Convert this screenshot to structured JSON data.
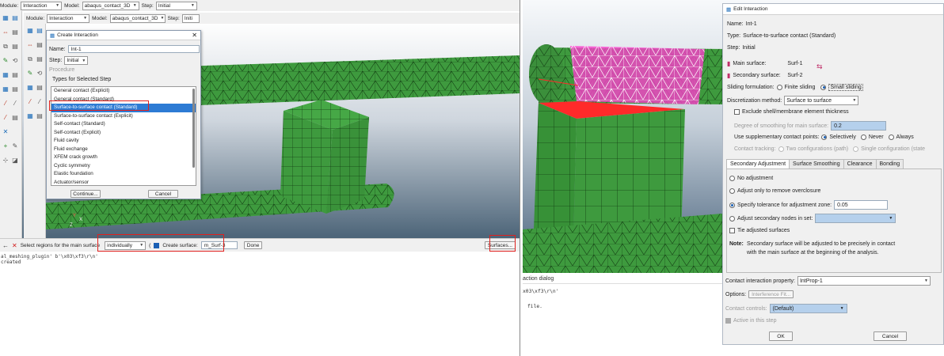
{
  "left": {
    "context_back": {
      "module_label": "Module:",
      "module_value": "Interaction",
      "model_label": "Model:",
      "model_value": "abaqus_contact_3D",
      "step_label": "Step:",
      "step_value": "Initial"
    },
    "context_front": {
      "module_label": "Module:",
      "module_value": "Interaction",
      "model_label": "Model:",
      "model_value": "abaqus_contact_3D",
      "step_label": "Step:",
      "step_value": "Initi"
    },
    "create_dialog": {
      "title": "Create Interaction",
      "name_label": "Name:",
      "name_value": "Int-1",
      "step_label": "Step:",
      "step_value": "Initial",
      "procedure_label": "Procedure",
      "types_label": "Types for Selected Step",
      "types": [
        "General contact (Explicit)",
        "General contact (Standard)",
        "Surface-to-surface contact (Standard)",
        "Surface-to-surface contact (Explicit)",
        "Self-contact (Standard)",
        "Self-contact (Explicit)",
        "Fluid cavity",
        "Fluid exchange",
        "XFEM crack growth",
        "Cyclic symmetry",
        "Elastic foundation",
        "Actuator/sensor"
      ],
      "selected_index": 2,
      "continue_label": "Continue...",
      "cancel_label": "Cancel"
    },
    "prompt": {
      "text": "Select regions for the main surface",
      "method_value": "individually",
      "create_surface_label": "Create surface:",
      "surface_name": "m_Surf-3",
      "done_label": "Done",
      "surfaces_label": "Surfaces..."
    },
    "messages": [
      "al_meshing_plugin'  b'\\x03\\xf3\\r\\n'",
      "created"
    ],
    "axis": {
      "x": "X",
      "y": "Y",
      "z": "Z"
    }
  },
  "right": {
    "edit": {
      "title": "Edit Interaction",
      "name_label": "Name:",
      "name_value": "Int-1",
      "type_label": "Type:",
      "type_value": "Surface-to-surface contact (Standard)",
      "step_label": "Step:",
      "step_value": "Initial",
      "main_surface_label": "Main surface:",
      "main_surface_value": "Surf-1",
      "secondary_surface_label": "Secondary surface:",
      "secondary_surface_value": "Surf-2",
      "sliding_label": "Sliding formulation:",
      "sliding_finite": "Finite sliding",
      "sliding_small": "Small sliding",
      "discretization_label": "Discretization method:",
      "discretization_value": "Surface to surface",
      "exclude_shell": "Exclude shell/membrane element thickness",
      "smoothing_label": "Degree of smoothing for main surface:",
      "smoothing_value": "0.2",
      "supp_label": "Use supplementary contact points:",
      "supp_selectively": "Selectively",
      "supp_never": "Never",
      "supp_always": "Always",
      "tracking_label": "Contact tracking:",
      "tracking_two": "Two configurations (path)",
      "tracking_single": "Single configuration (state",
      "tabs": [
        "Secondary Adjustment",
        "Surface Smoothing",
        "Clearance",
        "Bonding"
      ],
      "adj_none": "No adjustment",
      "adj_overclosure": "Adjust only to remove overclosure",
      "adj_tolerance": "Specify tolerance for adjustment zone:",
      "adj_tolerance_value": "0.05",
      "adj_nodes": "Adjust secondary nodes in set:",
      "tie_surfaces": "Tie adjusted surfaces",
      "note_label": "Note:",
      "note_line1": "Secondary surface will be adjusted to be precisely in contact",
      "note_line2": "with the main surface at the beginning of the analysis.",
      "property_label": "Contact interaction property:",
      "property_value": "IntProp-1",
      "options_label": "Options:",
      "interference_label": "Interference Fit...",
      "controls_label": "Contact controls:",
      "controls_value": "(Default)",
      "active_label": "Active in this step",
      "ok_label": "OK",
      "cancel_label": "Cancel"
    },
    "log": {
      "header": "action dialog",
      "line1": "x03\\xf3\\r\\n'",
      "line2": "file."
    }
  },
  "colors": {
    "mesh_green": "#3e9a3e",
    "highlight_magenta": "#ff3fd0",
    "highlight_red": "#ff2a2a",
    "annotation_red": "#e0201d",
    "selection_blue": "#2d7bd4",
    "field_blue": "#b5d0ec"
  }
}
